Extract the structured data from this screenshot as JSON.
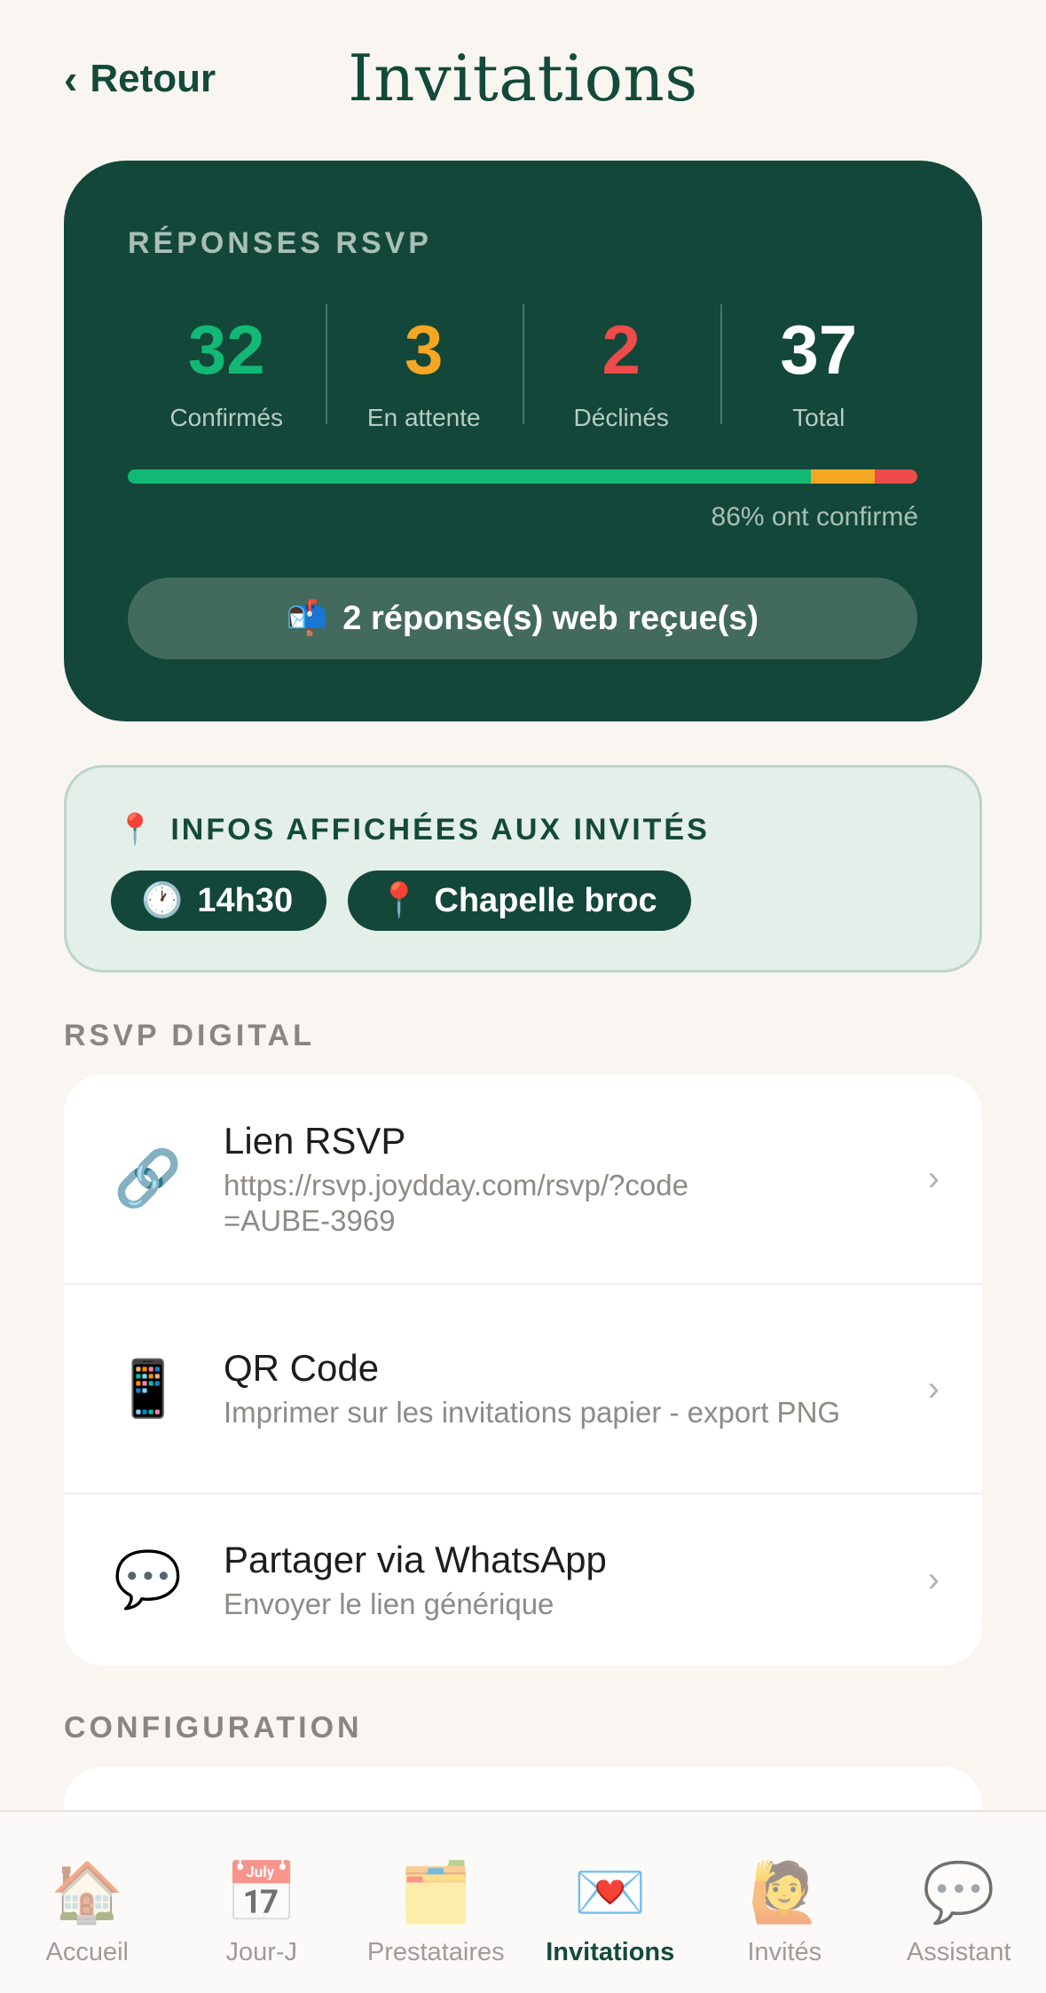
{
  "header": {
    "back_label": "Retour",
    "title": "Invitations"
  },
  "rsvp": {
    "label": "RÉPONSES RSVP",
    "stats": [
      {
        "value": "32",
        "label": "Confirmés"
      },
      {
        "value": "3",
        "label": "En attente"
      },
      {
        "value": "2",
        "label": "Déclinés"
      },
      {
        "value": "37",
        "label": "Total"
      }
    ],
    "progress": {
      "confirmed_pct": 86.5,
      "pending_pct": 8.1,
      "declined_pct": 5.4
    },
    "percent_text": "86% ont confirmé",
    "web_icon": "📬",
    "web_text": "2 réponse(s) web reçue(s)"
  },
  "infos": {
    "icon": "📍",
    "title": "INFOS AFFICHÉES AUX INVITÉS",
    "chips": [
      {
        "icon": "🕐",
        "label": "14h30"
      },
      {
        "icon": "📍",
        "label": "Chapelle broc"
      }
    ]
  },
  "sections": {
    "digital": "RSVP DIGITAL",
    "config": "CONFIGURATION"
  },
  "digital_items": [
    {
      "icon": "🔗",
      "title": "Lien RSVP",
      "subtitle": "https://rsvp.joydday.com/rsvp/?code=AUBE-3969"
    },
    {
      "icon": "📱",
      "title": "QR Code",
      "subtitle": "Imprimer sur les invitations papier - export PNG"
    },
    {
      "icon": "💬",
      "title": "Partager via WhatsApp",
      "subtitle": "Envoyer le lien générique"
    }
  ],
  "tabs": [
    {
      "icon": "🏠",
      "label": "Accueil"
    },
    {
      "icon": "📅",
      "label": "Jour-J"
    },
    {
      "icon": "🗂️",
      "label": "Prestataires"
    },
    {
      "icon": "💌",
      "label": "Invitations"
    },
    {
      "icon": "🙋",
      "label": "Invités"
    },
    {
      "icon": "💬",
      "label": "Assistant"
    }
  ],
  "colors": {
    "primary": "#124739",
    "confirmed": "#12b875",
    "pending": "#f5a623",
    "declined": "#ee4b4b"
  }
}
